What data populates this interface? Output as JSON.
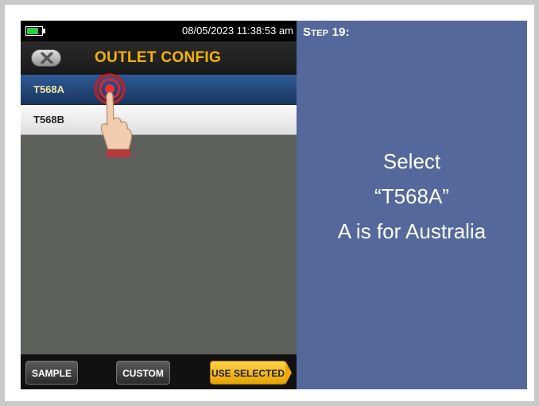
{
  "device": {
    "status": {
      "datetime": "08/05/2023 11:38:53 am"
    },
    "title": "OUTLET CONFIG",
    "options": [
      {
        "label": "T568A",
        "selected": true
      },
      {
        "label": "T568B",
        "selected": false
      }
    ],
    "buttons": {
      "sample": "SAMPLE",
      "custom": "CUSTOM",
      "use_selected": "USE SELECTED"
    }
  },
  "instruction": {
    "step": "Step 19:",
    "line1": "Select",
    "line2": "“T568A”",
    "line3": "A is for Australia"
  },
  "colors": {
    "accent": "#f5b400",
    "selected_row": "#2f5a97",
    "panel": "#54689c"
  },
  "icons": [
    "battery-icon",
    "close-icon",
    "tap-hand-icon"
  ]
}
